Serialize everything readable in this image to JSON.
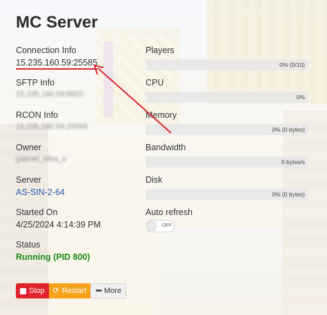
{
  "title": "MC Server",
  "left": {
    "connection": {
      "label": "Connection Info",
      "value": "15.235.160.59:25585"
    },
    "sftp": {
      "label": "SFTP Info",
      "value": "15.235.160.59:8822"
    },
    "rcon": {
      "label": "RCON Info",
      "value": "15.235.160.59:25595"
    },
    "owner": {
      "label": "Owner",
      "value": "gabriel_silva_s"
    },
    "server": {
      "label": "Server",
      "value": "AS-SIN-2-64"
    },
    "started": {
      "label": "Started On",
      "value": "4/25/2024 4:14:39 PM"
    },
    "status": {
      "label": "Status",
      "value": "Running (PID 800)"
    }
  },
  "right": {
    "players": {
      "label": "Players",
      "bar_text": "0% (0/10)",
      "percent": 0
    },
    "cpu": {
      "label": "CPU",
      "bar_text": "0%",
      "percent": 0
    },
    "memory": {
      "label": "Memory",
      "bar_text": "0% (0 bytes)",
      "percent": 0
    },
    "bandwidth": {
      "label": "Bandwidth",
      "bar_text": "0 bytes/s",
      "percent": 0
    },
    "disk": {
      "label": "Disk",
      "bar_text": "0% (0 bytes)",
      "percent": 0
    },
    "auto_refresh": {
      "label": "Auto refresh",
      "toggle_text": "OFF",
      "enabled": false
    }
  },
  "actions": {
    "stop": "Stop",
    "restart": "Restart",
    "more": "More"
  },
  "colors": {
    "running": "#1e8a1e",
    "stop": "#e0232d",
    "restart": "#f7a21b",
    "annotation": "#d9252f",
    "link": "#2a5ea8"
  },
  "icons": {
    "stop": "stop-square-icon",
    "restart": "refresh-icon",
    "more": "dots-icon"
  }
}
